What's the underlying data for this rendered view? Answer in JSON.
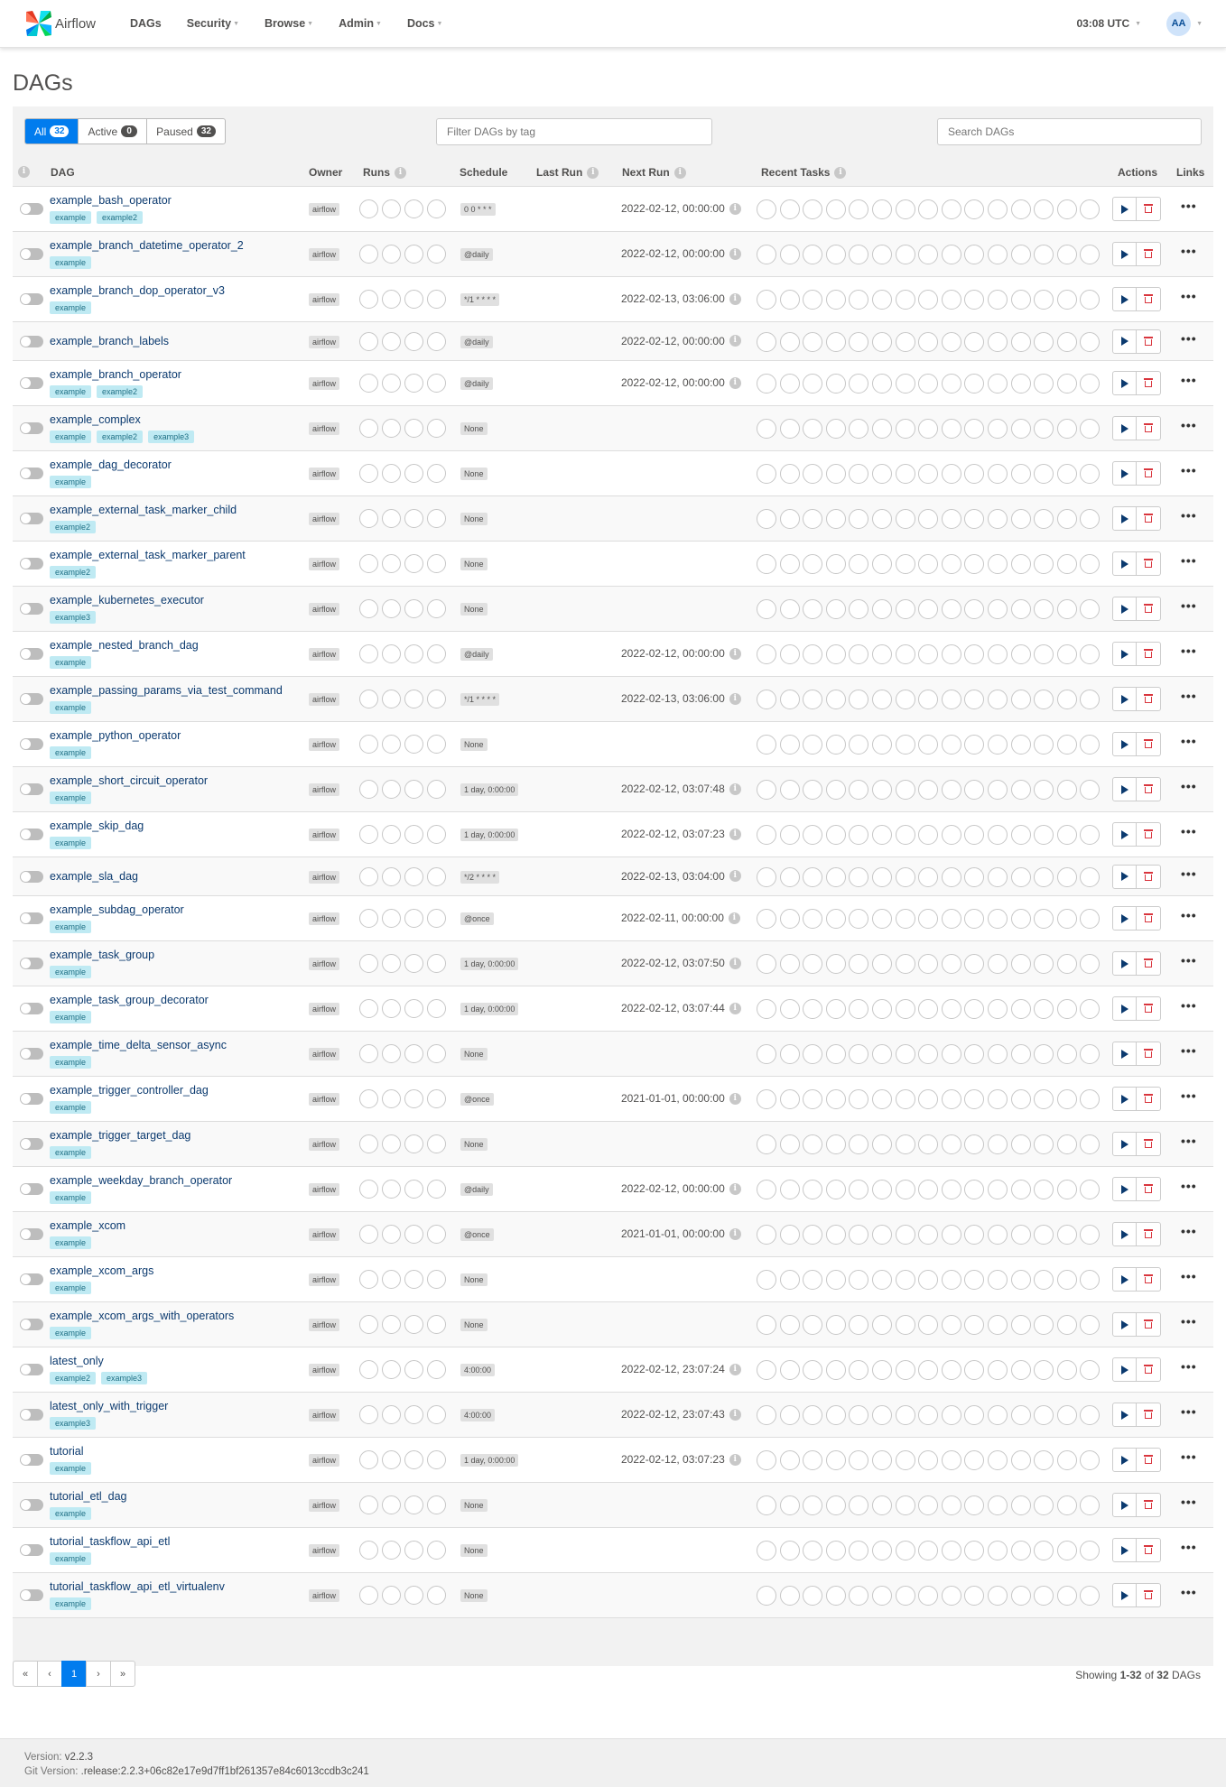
{
  "nav": {
    "brand": "Airflow",
    "menu": [
      "DAGs",
      "Security",
      "Browse",
      "Admin",
      "Docs"
    ],
    "clock": "03:08 UTC",
    "user_initials": "AA"
  },
  "page_title": "DAGs",
  "status_tabs": [
    {
      "label": "All",
      "count": "32"
    },
    {
      "label": "Active",
      "count": "0"
    },
    {
      "label": "Paused",
      "count": "32"
    }
  ],
  "tag_filter_placeholder": "Filter DAGs by tag",
  "search_placeholder": "Search DAGs",
  "columns": {
    "dag": "DAG",
    "owner": "Owner",
    "runs": "Runs",
    "schedule": "Schedule",
    "last_run": "Last Run",
    "next_run": "Next Run",
    "recent_tasks": "Recent Tasks",
    "actions": "Actions",
    "links": "Links"
  },
  "dags": [
    {
      "name": "example_bash_operator",
      "tags": [
        "example",
        "example2"
      ],
      "owner": "airflow",
      "schedule": "0 0 * * *",
      "next_run": "2022-02-12, 00:00:00"
    },
    {
      "name": "example_branch_datetime_operator_2",
      "tags": [
        "example"
      ],
      "owner": "airflow",
      "schedule": "@daily",
      "next_run": "2022-02-12, 00:00:00"
    },
    {
      "name": "example_branch_dop_operator_v3",
      "tags": [
        "example"
      ],
      "owner": "airflow",
      "schedule": "*/1 * * * *",
      "next_run": "2022-02-13, 03:06:00"
    },
    {
      "name": "example_branch_labels",
      "tags": [],
      "owner": "airflow",
      "schedule": "@daily",
      "next_run": "2022-02-12, 00:00:00"
    },
    {
      "name": "example_branch_operator",
      "tags": [
        "example",
        "example2"
      ],
      "owner": "airflow",
      "schedule": "@daily",
      "next_run": "2022-02-12, 00:00:00"
    },
    {
      "name": "example_complex",
      "tags": [
        "example",
        "example2",
        "example3"
      ],
      "owner": "airflow",
      "schedule": "None",
      "next_run": ""
    },
    {
      "name": "example_dag_decorator",
      "tags": [
        "example"
      ],
      "owner": "airflow",
      "schedule": "None",
      "next_run": ""
    },
    {
      "name": "example_external_task_marker_child",
      "tags": [
        "example2"
      ],
      "owner": "airflow",
      "schedule": "None",
      "next_run": ""
    },
    {
      "name": "example_external_task_marker_parent",
      "tags": [
        "example2"
      ],
      "owner": "airflow",
      "schedule": "None",
      "next_run": ""
    },
    {
      "name": "example_kubernetes_executor",
      "tags": [
        "example3"
      ],
      "owner": "airflow",
      "schedule": "None",
      "next_run": ""
    },
    {
      "name": "example_nested_branch_dag",
      "tags": [
        "example"
      ],
      "owner": "airflow",
      "schedule": "@daily",
      "next_run": "2022-02-12, 00:00:00"
    },
    {
      "name": "example_passing_params_via_test_command",
      "tags": [
        "example"
      ],
      "owner": "airflow",
      "schedule": "*/1 * * * *",
      "next_run": "2022-02-13, 03:06:00"
    },
    {
      "name": "example_python_operator",
      "tags": [
        "example"
      ],
      "owner": "airflow",
      "schedule": "None",
      "next_run": ""
    },
    {
      "name": "example_short_circuit_operator",
      "tags": [
        "example"
      ],
      "owner": "airflow",
      "schedule": "1 day, 0:00:00",
      "next_run": "2022-02-12, 03:07:48"
    },
    {
      "name": "example_skip_dag",
      "tags": [
        "example"
      ],
      "owner": "airflow",
      "schedule": "1 day, 0:00:00",
      "next_run": "2022-02-12, 03:07:23"
    },
    {
      "name": "example_sla_dag",
      "tags": [],
      "owner": "airflow",
      "schedule": "*/2 * * * *",
      "next_run": "2022-02-13, 03:04:00"
    },
    {
      "name": "example_subdag_operator",
      "tags": [
        "example"
      ],
      "owner": "airflow",
      "schedule": "@once",
      "next_run": "2022-02-11, 00:00:00"
    },
    {
      "name": "example_task_group",
      "tags": [
        "example"
      ],
      "owner": "airflow",
      "schedule": "1 day, 0:00:00",
      "next_run": "2022-02-12, 03:07:50"
    },
    {
      "name": "example_task_group_decorator",
      "tags": [
        "example"
      ],
      "owner": "airflow",
      "schedule": "1 day, 0:00:00",
      "next_run": "2022-02-12, 03:07:44"
    },
    {
      "name": "example_time_delta_sensor_async",
      "tags": [
        "example"
      ],
      "owner": "airflow",
      "schedule": "None",
      "next_run": ""
    },
    {
      "name": "example_trigger_controller_dag",
      "tags": [
        "example"
      ],
      "owner": "airflow",
      "schedule": "@once",
      "next_run": "2021-01-01, 00:00:00"
    },
    {
      "name": "example_trigger_target_dag",
      "tags": [
        "example"
      ],
      "owner": "airflow",
      "schedule": "None",
      "next_run": ""
    },
    {
      "name": "example_weekday_branch_operator",
      "tags": [
        "example"
      ],
      "owner": "airflow",
      "schedule": "@daily",
      "next_run": "2022-02-12, 00:00:00"
    },
    {
      "name": "example_xcom",
      "tags": [
        "example"
      ],
      "owner": "airflow",
      "schedule": "@once",
      "next_run": "2021-01-01, 00:00:00"
    },
    {
      "name": "example_xcom_args",
      "tags": [
        "example"
      ],
      "owner": "airflow",
      "schedule": "None",
      "next_run": ""
    },
    {
      "name": "example_xcom_args_with_operators",
      "tags": [
        "example"
      ],
      "owner": "airflow",
      "schedule": "None",
      "next_run": ""
    },
    {
      "name": "latest_only",
      "tags": [
        "example2",
        "example3"
      ],
      "owner": "airflow",
      "schedule": "4:00:00",
      "next_run": "2022-02-12, 23:07:24"
    },
    {
      "name": "latest_only_with_trigger",
      "tags": [
        "example3"
      ],
      "owner": "airflow",
      "schedule": "4:00:00",
      "next_run": "2022-02-12, 23:07:43"
    },
    {
      "name": "tutorial",
      "tags": [
        "example"
      ],
      "owner": "airflow",
      "schedule": "1 day, 0:00:00",
      "next_run": "2022-02-12, 03:07:23"
    },
    {
      "name": "tutorial_etl_dag",
      "tags": [
        "example"
      ],
      "owner": "airflow",
      "schedule": "None",
      "next_run": ""
    },
    {
      "name": "tutorial_taskflow_api_etl",
      "tags": [
        "example"
      ],
      "owner": "airflow",
      "schedule": "None",
      "next_run": ""
    },
    {
      "name": "tutorial_taskflow_api_etl_virtualenv",
      "tags": [
        "example"
      ],
      "owner": "airflow",
      "schedule": "None",
      "next_run": ""
    }
  ],
  "pagination": {
    "first": "«",
    "prev": "‹",
    "current": "1",
    "next": "›",
    "last": "»"
  },
  "showing": {
    "prefix": "Showing ",
    "range": "1-32",
    "of": " of ",
    "total": "32",
    "suffix": " DAGs"
  },
  "footer": {
    "version_label": "Version: ",
    "version": "v2.2.3",
    "git_label": "Git Version: ",
    "git_version": ".release:2.2.3+06c82e17e9d7ff1bf261357e84c6013ccdb3c241"
  },
  "colors": {
    "accent": "#017cee",
    "link": "#0b3a6f",
    "tag_bg": "#bfeaf3",
    "delete": "#d9363e"
  }
}
